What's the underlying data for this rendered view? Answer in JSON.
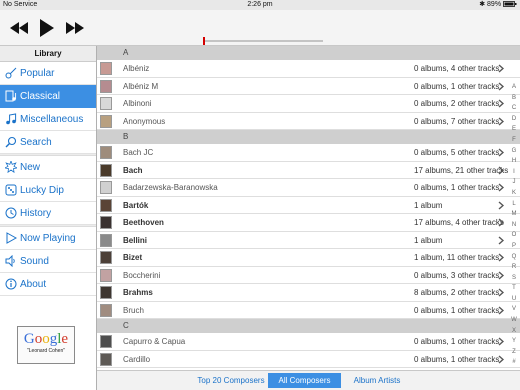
{
  "status": {
    "carrier": "No Service",
    "time": "2:26 pm",
    "battery": "89%"
  },
  "player": {
    "prev_icon": "rewind-icon",
    "play_icon": "play-icon",
    "next_icon": "fast-forward-icon",
    "progress": 0.0
  },
  "sidebar": {
    "title": "Library",
    "groups": [
      [
        {
          "label": "Popular",
          "icon": "guitar-icon"
        },
        {
          "label": "Classical",
          "icon": "sheet-music-icon",
          "selected": true
        },
        {
          "label": "Miscellaneous",
          "icon": "notes-icon"
        },
        {
          "label": "Search",
          "icon": "search-icon"
        }
      ],
      [
        {
          "label": "New",
          "icon": "starburst-icon"
        },
        {
          "label": "Lucky Dip",
          "icon": "dice-icon"
        },
        {
          "label": "History",
          "icon": "clock-icon"
        }
      ],
      [
        {
          "label": "Now Playing",
          "icon": "play-icon"
        },
        {
          "label": "Sound",
          "icon": "speaker-icon"
        },
        {
          "label": "About",
          "icon": "info-icon"
        }
      ]
    ],
    "google": {
      "logo": "Google",
      "query": "\"Leonard Cohen\""
    }
  },
  "list": {
    "sections": [
      {
        "letter": "A",
        "rows": [
          {
            "name": "Albéniz",
            "info": "0 albums, 4 other tracks",
            "bold": false,
            "thumb": "#c79a94"
          },
          {
            "name": "Albéniz M",
            "info": "0 albums, 1 other tracks",
            "bold": false,
            "thumb": "#b58c90"
          },
          {
            "name": "Albinoni",
            "info": "0 albums, 2 other tracks",
            "bold": false,
            "thumb": "#d8d8d8"
          },
          {
            "name": "Anonymous",
            "info": "0 albums, 7 other tracks",
            "bold": false,
            "thumb": "#b8a080"
          }
        ]
      },
      {
        "letter": "B",
        "rows": [
          {
            "name": "Bach JC",
            "info": "0 albums, 5 other tracks",
            "bold": false,
            "thumb": "#9e8c7c"
          },
          {
            "name": "Bach",
            "info": "17 albums, 21 other tracks",
            "bold": true,
            "thumb": "#4a3a2a"
          },
          {
            "name": "Badarzewska-Baranowska",
            "info": "0 albums, 1 other tracks",
            "bold": false,
            "thumb": "#d0d0d0"
          },
          {
            "name": "Bartók",
            "info": "1 album",
            "bold": true,
            "thumb": "#5a4436"
          },
          {
            "name": "Beethoven",
            "info": "17 albums, 4 other tracks",
            "bold": true,
            "thumb": "#3a3230"
          },
          {
            "name": "Bellini",
            "info": "1 album",
            "bold": true,
            "thumb": "#8a8a8a"
          },
          {
            "name": "Bizet",
            "info": "1 album, 11 other tracks",
            "bold": true,
            "thumb": "#4c4038"
          },
          {
            "name": "Boccherini",
            "info": "0 albums, 3 other tracks",
            "bold": false,
            "thumb": "#c2a2a2"
          },
          {
            "name": "Brahms",
            "info": "8 albums, 2 other tracks",
            "bold": true,
            "thumb": "#3e3630"
          },
          {
            "name": "Bruch",
            "info": "0 albums, 1 other tracks",
            "bold": false,
            "thumb": "#a08c80"
          }
        ]
      },
      {
        "letter": "C",
        "rows": [
          {
            "name": "Capurro & Capua",
            "info": "0 albums, 1 other tracks",
            "bold": false,
            "thumb": "#4e4e4e"
          },
          {
            "name": "Cardillo",
            "info": "0 albums, 1 other tracks",
            "bold": false,
            "thumb": "#5e5a56"
          },
          {
            "name": "",
            "info": "",
            "bold": false,
            "thumb": "#5c5450"
          }
        ]
      }
    ]
  },
  "index_letters": [
    "A",
    "B",
    "C",
    "D",
    "E",
    "F",
    "G",
    "H",
    "I",
    "J",
    "K",
    "L",
    "M",
    "N",
    "O",
    "P",
    "Q",
    "R",
    "S",
    "T",
    "U",
    "V",
    "W",
    "X",
    "Y",
    "Z",
    "#"
  ],
  "tabs": [
    {
      "label": "Top 20 Composers",
      "selected": false
    },
    {
      "label": "All Composers",
      "selected": true
    },
    {
      "label": "Album Artists",
      "selected": false
    }
  ],
  "colors": {
    "accent": "#3c8fe3",
    "link": "#1a72c9",
    "section_bg": "#cfcfcf",
    "progress_knob": "#d40000"
  }
}
